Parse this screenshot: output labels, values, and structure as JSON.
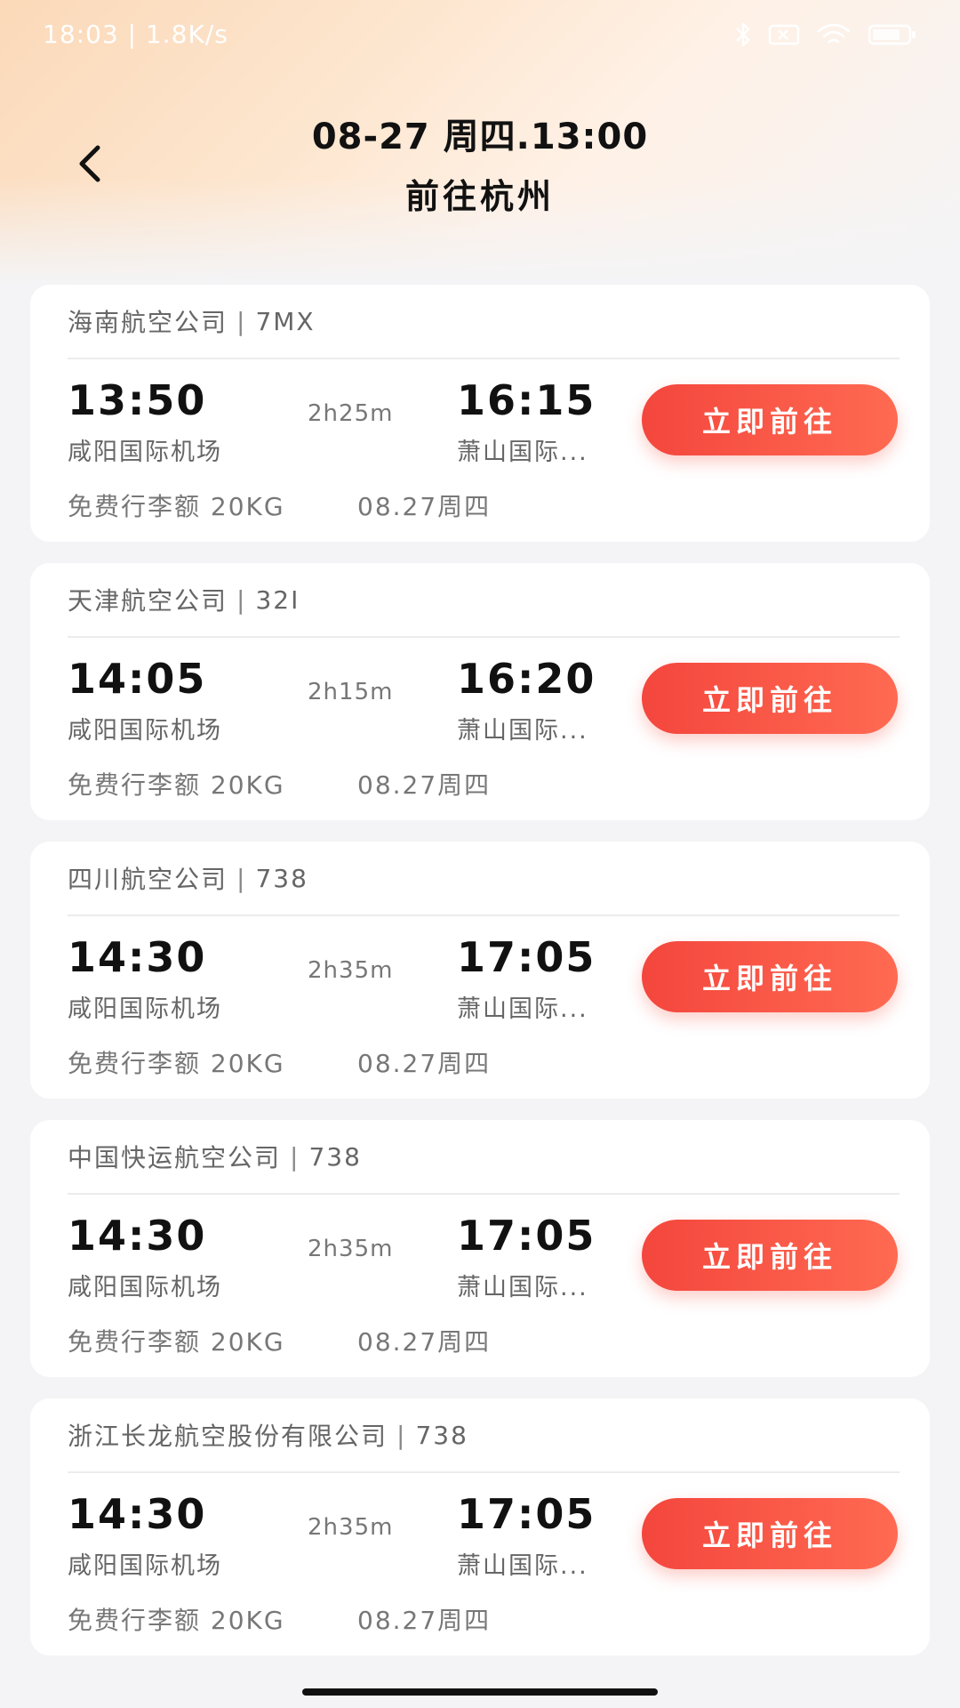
{
  "status_bar": {
    "left_text": "18:03 | 1.8K/s",
    "icons": [
      "bluetooth-icon",
      "sim-icon",
      "wifi-icon",
      "battery-icon"
    ]
  },
  "header": {
    "back_icon": "chevron-left-icon",
    "title_line1": "08-27 周四.13:00",
    "title_line2": "前往杭州"
  },
  "flights": [
    {
      "airline": "海南航空公司",
      "separator": "|",
      "aircraft": "7MX",
      "dep_time": "13:50",
      "dep_airport": "咸阳国际机场",
      "duration": "2h25m",
      "arr_time": "16:15",
      "arr_airport": "萧山国际...",
      "baggage": "免费行李额 20KG",
      "date": "08.27周四",
      "button_label": "立即前往"
    },
    {
      "airline": "天津航空公司",
      "separator": "|",
      "aircraft": "32I",
      "dep_time": "14:05",
      "dep_airport": "咸阳国际机场",
      "duration": "2h15m",
      "arr_time": "16:20",
      "arr_airport": "萧山国际...",
      "baggage": "免费行李额 20KG",
      "date": "08.27周四",
      "button_label": "立即前往"
    },
    {
      "airline": "四川航空公司",
      "separator": "|",
      "aircraft": "738",
      "dep_time": "14:30",
      "dep_airport": "咸阳国际机场",
      "duration": "2h35m",
      "arr_time": "17:05",
      "arr_airport": "萧山国际...",
      "baggage": "免费行李额 20KG",
      "date": "08.27周四",
      "button_label": "立即前往"
    },
    {
      "airline": "中国快运航空公司",
      "separator": "|",
      "aircraft": "738",
      "dep_time": "14:30",
      "dep_airport": "咸阳国际机场",
      "duration": "2h35m",
      "arr_time": "17:05",
      "arr_airport": "萧山国际...",
      "baggage": "免费行李额 20KG",
      "date": "08.27周四",
      "button_label": "立即前往"
    },
    {
      "airline": "浙江长龙航空股份有限公司",
      "separator": "|",
      "aircraft": "738",
      "dep_time": "14:30",
      "dep_airport": "咸阳国际机场",
      "duration": "2h35m",
      "arr_time": "17:05",
      "arr_airport": "萧山国际...",
      "baggage": "免费行李额 20KG",
      "date": "08.27周四",
      "button_label": "立即前往"
    }
  ],
  "colors": {
    "accent_start": "#f4463d",
    "accent_end": "#ff6a52",
    "page_background": "#f4f4f6"
  }
}
